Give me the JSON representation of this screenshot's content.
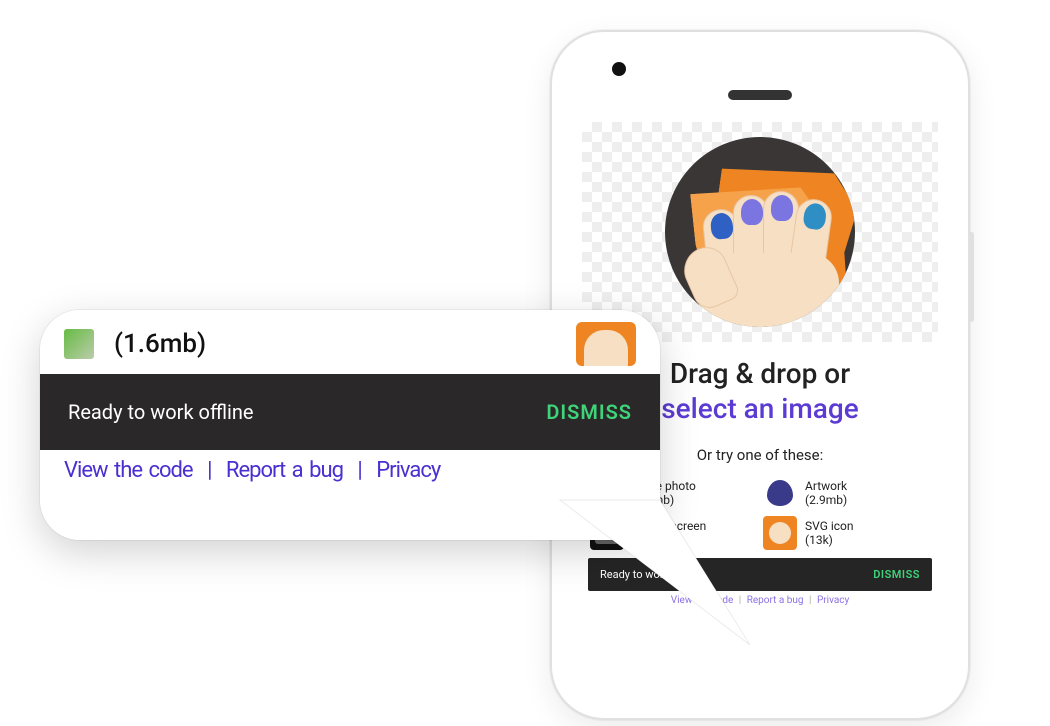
{
  "headline": {
    "line1": "Drag & drop or",
    "line2": "select an image"
  },
  "subhead": "Or try one of these:",
  "samples": {
    "large_photo": {
      "label_line1": "Large photo",
      "label_line2": "(2.8mb)"
    },
    "artwork": {
      "label_line1": "Artwork",
      "label_line2": "(2.9mb)"
    },
    "device_screen": {
      "label_line1": "Device screen",
      "label_line2": "(1.6mb)"
    },
    "svg_icon": {
      "label_line1": "SVG icon",
      "label_line2": "(13k)"
    }
  },
  "snackbar": {
    "message": "Ready to work offline",
    "action": "DISMISS"
  },
  "footer": {
    "view_code": "View the code",
    "report_bug": "Report a bug",
    "privacy": "Privacy",
    "sep": "|"
  },
  "zoom": {
    "peek_size": "(1.6mb)",
    "peek_footer_view": "View the code",
    "peek_footer_report": "Report a bug",
    "peek_footer_privacy": "Privacy"
  }
}
